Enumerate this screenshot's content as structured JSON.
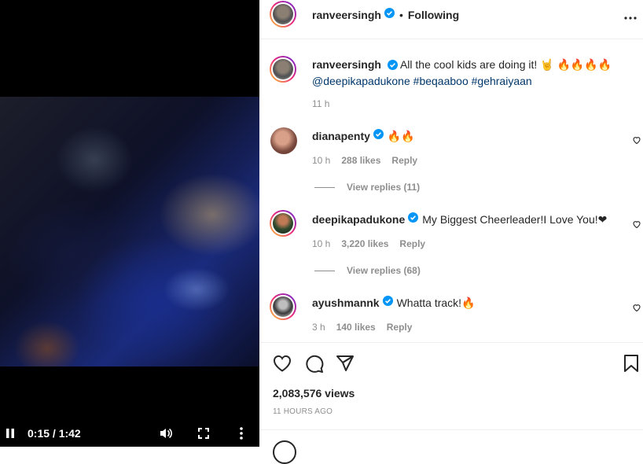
{
  "video": {
    "time": "0:15 / 1:42"
  },
  "header": {
    "username": "ranveersingh",
    "separator": "•",
    "follow_status": "Following"
  },
  "caption": {
    "username": "ranveersingh",
    "text": "All the cool kids are doing it! ",
    "emojis": "🤘 🔥🔥🔥🔥",
    "mention": "@deepikapadukone",
    "tag1": "#beqaaboo",
    "tag2": "#gehraiyaan",
    "time": "11 h"
  },
  "comments": [
    {
      "username": "dianapenty",
      "text": "🔥🔥",
      "time": "10 h",
      "likes": "288 likes",
      "reply": "Reply",
      "view_replies": "View replies (11)"
    },
    {
      "username": "deepikapadukone",
      "text": "My Biggest Cheerleader!I Love You!❤",
      "time": "10 h",
      "likes": "3,220 likes",
      "reply": "Reply",
      "view_replies": "View replies (68)"
    },
    {
      "username": "ayushmannk",
      "text": "Whatta track!🔥",
      "time": "3 h",
      "likes": "140 likes",
      "reply": "Reply"
    }
  ],
  "stats": {
    "views": "2,083,576 views",
    "posted": "11 HOURS AGO"
  },
  "colors": {
    "verified": "#0095f6",
    "text": "#262626",
    "muted": "#8e8e8e",
    "link": "#00376b"
  }
}
